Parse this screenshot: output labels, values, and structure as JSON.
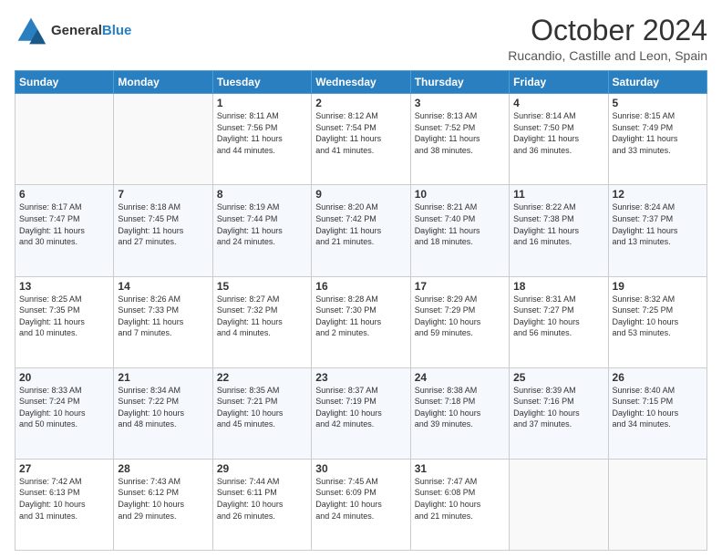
{
  "header": {
    "logo_general": "General",
    "logo_blue": "Blue",
    "title": "October 2024",
    "subtitle": "Rucandio, Castille and Leon, Spain"
  },
  "calendar": {
    "days_of_week": [
      "Sunday",
      "Monday",
      "Tuesday",
      "Wednesday",
      "Thursday",
      "Friday",
      "Saturday"
    ],
    "weeks": [
      [
        {
          "day": "",
          "info": ""
        },
        {
          "day": "",
          "info": ""
        },
        {
          "day": "1",
          "info": "Sunrise: 8:11 AM\nSunset: 7:56 PM\nDaylight: 11 hours\nand 44 minutes."
        },
        {
          "day": "2",
          "info": "Sunrise: 8:12 AM\nSunset: 7:54 PM\nDaylight: 11 hours\nand 41 minutes."
        },
        {
          "day": "3",
          "info": "Sunrise: 8:13 AM\nSunset: 7:52 PM\nDaylight: 11 hours\nand 38 minutes."
        },
        {
          "day": "4",
          "info": "Sunrise: 8:14 AM\nSunset: 7:50 PM\nDaylight: 11 hours\nand 36 minutes."
        },
        {
          "day": "5",
          "info": "Sunrise: 8:15 AM\nSunset: 7:49 PM\nDaylight: 11 hours\nand 33 minutes."
        }
      ],
      [
        {
          "day": "6",
          "info": "Sunrise: 8:17 AM\nSunset: 7:47 PM\nDaylight: 11 hours\nand 30 minutes."
        },
        {
          "day": "7",
          "info": "Sunrise: 8:18 AM\nSunset: 7:45 PM\nDaylight: 11 hours\nand 27 minutes."
        },
        {
          "day": "8",
          "info": "Sunrise: 8:19 AM\nSunset: 7:44 PM\nDaylight: 11 hours\nand 24 minutes."
        },
        {
          "day": "9",
          "info": "Sunrise: 8:20 AM\nSunset: 7:42 PM\nDaylight: 11 hours\nand 21 minutes."
        },
        {
          "day": "10",
          "info": "Sunrise: 8:21 AM\nSunset: 7:40 PM\nDaylight: 11 hours\nand 18 minutes."
        },
        {
          "day": "11",
          "info": "Sunrise: 8:22 AM\nSunset: 7:38 PM\nDaylight: 11 hours\nand 16 minutes."
        },
        {
          "day": "12",
          "info": "Sunrise: 8:24 AM\nSunset: 7:37 PM\nDaylight: 11 hours\nand 13 minutes."
        }
      ],
      [
        {
          "day": "13",
          "info": "Sunrise: 8:25 AM\nSunset: 7:35 PM\nDaylight: 11 hours\nand 10 minutes."
        },
        {
          "day": "14",
          "info": "Sunrise: 8:26 AM\nSunset: 7:33 PM\nDaylight: 11 hours\nand 7 minutes."
        },
        {
          "day": "15",
          "info": "Sunrise: 8:27 AM\nSunset: 7:32 PM\nDaylight: 11 hours\nand 4 minutes."
        },
        {
          "day": "16",
          "info": "Sunrise: 8:28 AM\nSunset: 7:30 PM\nDaylight: 11 hours\nand 2 minutes."
        },
        {
          "day": "17",
          "info": "Sunrise: 8:29 AM\nSunset: 7:29 PM\nDaylight: 10 hours\nand 59 minutes."
        },
        {
          "day": "18",
          "info": "Sunrise: 8:31 AM\nSunset: 7:27 PM\nDaylight: 10 hours\nand 56 minutes."
        },
        {
          "day": "19",
          "info": "Sunrise: 8:32 AM\nSunset: 7:25 PM\nDaylight: 10 hours\nand 53 minutes."
        }
      ],
      [
        {
          "day": "20",
          "info": "Sunrise: 8:33 AM\nSunset: 7:24 PM\nDaylight: 10 hours\nand 50 minutes."
        },
        {
          "day": "21",
          "info": "Sunrise: 8:34 AM\nSunset: 7:22 PM\nDaylight: 10 hours\nand 48 minutes."
        },
        {
          "day": "22",
          "info": "Sunrise: 8:35 AM\nSunset: 7:21 PM\nDaylight: 10 hours\nand 45 minutes."
        },
        {
          "day": "23",
          "info": "Sunrise: 8:37 AM\nSunset: 7:19 PM\nDaylight: 10 hours\nand 42 minutes."
        },
        {
          "day": "24",
          "info": "Sunrise: 8:38 AM\nSunset: 7:18 PM\nDaylight: 10 hours\nand 39 minutes."
        },
        {
          "day": "25",
          "info": "Sunrise: 8:39 AM\nSunset: 7:16 PM\nDaylight: 10 hours\nand 37 minutes."
        },
        {
          "day": "26",
          "info": "Sunrise: 8:40 AM\nSunset: 7:15 PM\nDaylight: 10 hours\nand 34 minutes."
        }
      ],
      [
        {
          "day": "27",
          "info": "Sunrise: 7:42 AM\nSunset: 6:13 PM\nDaylight: 10 hours\nand 31 minutes."
        },
        {
          "day": "28",
          "info": "Sunrise: 7:43 AM\nSunset: 6:12 PM\nDaylight: 10 hours\nand 29 minutes."
        },
        {
          "day": "29",
          "info": "Sunrise: 7:44 AM\nSunset: 6:11 PM\nDaylight: 10 hours\nand 26 minutes."
        },
        {
          "day": "30",
          "info": "Sunrise: 7:45 AM\nSunset: 6:09 PM\nDaylight: 10 hours\nand 24 minutes."
        },
        {
          "day": "31",
          "info": "Sunrise: 7:47 AM\nSunset: 6:08 PM\nDaylight: 10 hours\nand 21 minutes."
        },
        {
          "day": "",
          "info": ""
        },
        {
          "day": "",
          "info": ""
        }
      ]
    ]
  }
}
